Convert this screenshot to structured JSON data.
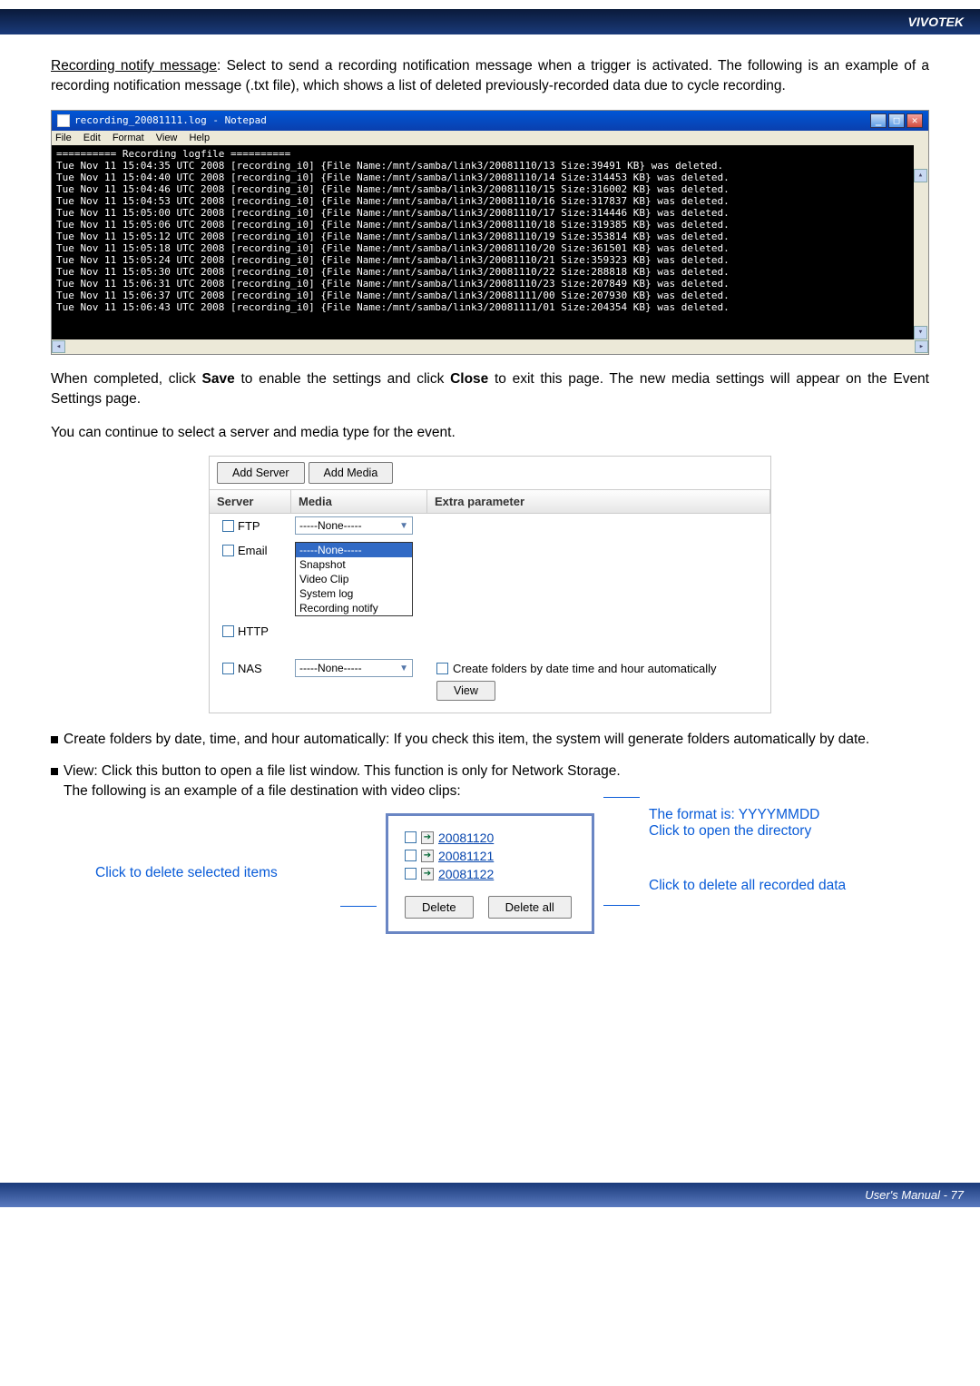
{
  "header": {
    "brand": "VIVOTEK"
  },
  "intro": {
    "label": "Recording notify message",
    "text": ": Select to send a recording notification message when a trigger is activated. The following is an example of a recording notification message (.txt file), which shows a list of deleted previously-recorded data due to cycle recording."
  },
  "notepad": {
    "title": "recording_20081111.log - Notepad",
    "menu": [
      "File",
      "Edit",
      "Format",
      "View",
      "Help"
    ],
    "lines": [
      "========== Recording logfile ==========",
      "Tue Nov 11 15:04:35 UTC 2008 [recording_i0] {File Name:/mnt/samba/link3/20081110/13 Size:39491 KB} was deleted.",
      "Tue Nov 11 15:04:40 UTC 2008 [recording_i0] {File Name:/mnt/samba/link3/20081110/14 Size:314453 KB} was deleted.",
      "Tue Nov 11 15:04:46 UTC 2008 [recording_i0] {File Name:/mnt/samba/link3/20081110/15 Size:316002 KB} was deleted.",
      "Tue Nov 11 15:04:53 UTC 2008 [recording_i0] {File Name:/mnt/samba/link3/20081110/16 Size:317837 KB} was deleted.",
      "Tue Nov 11 15:05:00 UTC 2008 [recording_i0] {File Name:/mnt/samba/link3/20081110/17 Size:314446 KB} was deleted.",
      "Tue Nov 11 15:05:06 UTC 2008 [recording_i0] {File Name:/mnt/samba/link3/20081110/18 Size:319385 KB} was deleted.",
      "Tue Nov 11 15:05:12 UTC 2008 [recording_i0] {File Name:/mnt/samba/link3/20081110/19 Size:353814 KB} was deleted.",
      "Tue Nov 11 15:05:18 UTC 2008 [recording_i0] {File Name:/mnt/samba/link3/20081110/20 Size:361501 KB} was deleted.",
      "Tue Nov 11 15:05:24 UTC 2008 [recording_i0] {File Name:/mnt/samba/link3/20081110/21 Size:359323 KB} was deleted.",
      "Tue Nov 11 15:05:30 UTC 2008 [recording_i0] {File Name:/mnt/samba/link3/20081110/22 Size:288818 KB} was deleted.",
      "Tue Nov 11 15:06:31 UTC 2008 [recording_i0] {File Name:/mnt/samba/link3/20081110/23 Size:207849 KB} was deleted.",
      "Tue Nov 11 15:06:37 UTC 2008 [recording_i0] {File Name:/mnt/samba/link3/20081111/00 Size:207930 KB} was deleted.",
      "Tue Nov 11 15:06:43 UTC 2008 [recording_i0] {File Name:/mnt/samba/link3/20081111/01 Size:204354 KB} was deleted."
    ]
  },
  "post_np_para1_a": "When completed, click ",
  "post_np_para1_b": "Save",
  "post_np_para1_c": " to enable the settings and click ",
  "post_np_para1_d": "Close",
  "post_np_para1_e": " to exit this page. The new media settings will appear on the Event Settings page.",
  "post_np_para2": "You can continue to select a server and media type for the event.",
  "sm": {
    "btn_addserver": "Add Server",
    "btn_addmedia": "Add Media",
    "head": {
      "server": "Server",
      "media": "Media",
      "extra": "Extra parameter"
    },
    "rows": {
      "ftp": {
        "label": "FTP",
        "media": "-----None-----"
      },
      "email": {
        "label": "Email"
      },
      "http": {
        "label": "HTTP"
      },
      "nas": {
        "label": "NAS",
        "media": "-----None-----"
      }
    },
    "dd": [
      "-----None-----",
      "Snapshot",
      "Video Clip",
      "System log",
      "Recording notify"
    ],
    "createfolders": "Create folders by date time and hour automatically",
    "view": "View"
  },
  "bullet1": "Create folders by date, time, and hour automatically: If you check this item, the system will generate folders automatically by date.",
  "bullet2a": "View: Click this button to open a file list window. This function is only for Network Storage.",
  "bullet2b": "The following is an example of a file destination with video clips:",
  "filedest": {
    "items": [
      "20081120",
      "20081121",
      "20081122"
    ],
    "delete": "Delete",
    "deleteall": "Delete all"
  },
  "callouts": {
    "left": "Click to delete selected items",
    "right1": "The format is: YYYYMMDD",
    "right2": "Click to open the directory",
    "right3": "Click to delete all recorded data"
  },
  "footer": "User's Manual - 77"
}
